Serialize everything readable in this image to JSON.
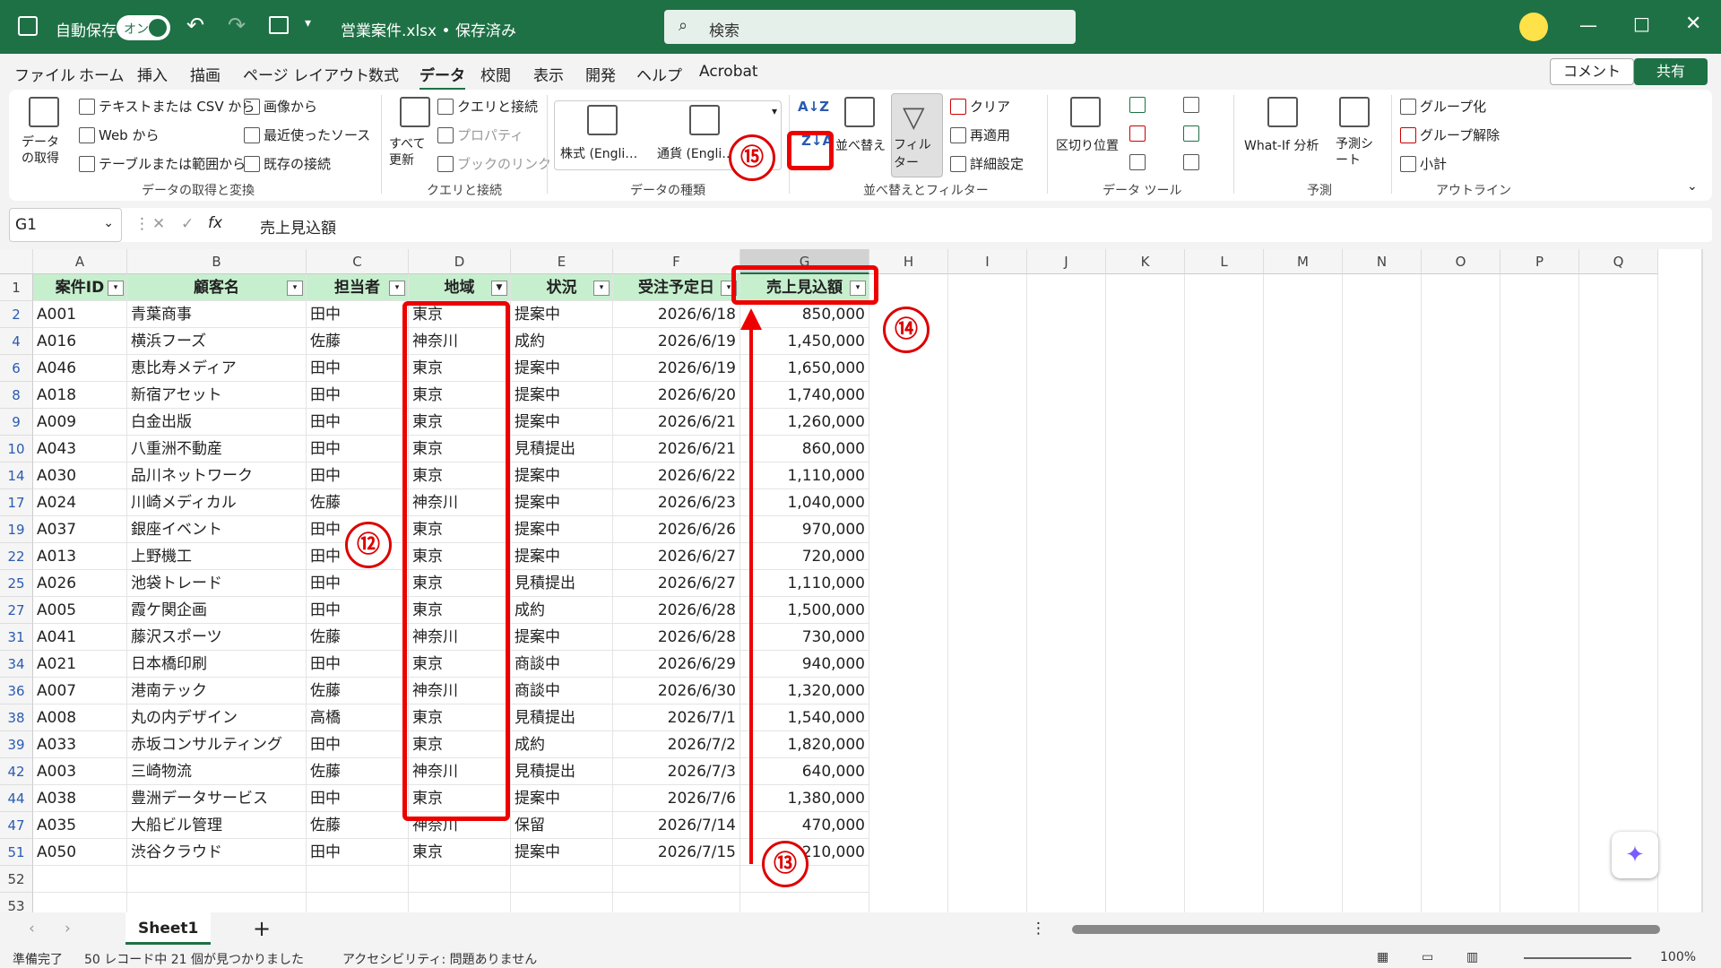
{
  "titlebar": {
    "autosave_label": "自動保存",
    "autosave_state": "オン",
    "file_name": "営業案件.xlsx • 保存済み",
    "search_placeholder": "検索"
  },
  "menu": {
    "tabs": [
      "ファイル",
      "ホーム",
      "挿入",
      "描画",
      "ページ レイアウト",
      "数式",
      "データ",
      "校閲",
      "表示",
      "開発",
      "ヘルプ",
      "Acrobat"
    ],
    "active_tab": "データ",
    "comment_label": "コメント",
    "share_label": "共有"
  },
  "ribbon": {
    "get_data": "データの取得",
    "from_text_csv": "テキストまたは CSV から",
    "from_web": "Web から",
    "from_table": "テーブルまたは範囲から",
    "from_image": "画像から",
    "recent_sources": "最近使ったソース",
    "existing_conn": "既存の接続",
    "group_get": "データの取得と変換",
    "refresh_all": "すべて更新",
    "queries_conn": "クエリと接続",
    "properties": "プロパティ",
    "book_links": "ブックのリンク",
    "group_queries": "クエリと接続",
    "stocks": "株式 (Engli…",
    "currency": "通貨 (Engli…",
    "group_types": "データの種類",
    "sort_asc": "A↓Z",
    "sort_desc": "Z↓A",
    "sort": "並べ替え",
    "filter": "フィルター",
    "clear": "クリア",
    "reapply": "再適用",
    "advanced": "詳細設定",
    "group_sort": "並べ替えとフィルター",
    "text_to_columns": "区切り位置",
    "group_tools": "データ ツール",
    "whatif": "What-If 分析",
    "forecast_sheet": "予測シート",
    "group_forecast": "予測",
    "group_btn": "グループ化",
    "ungroup_btn": "グループ解除",
    "subtotal": "小計",
    "group_outline": "アウトライン"
  },
  "formula_bar": {
    "name_box": "G1",
    "fx": "fx",
    "content": "売上見込額"
  },
  "columns": [
    "A",
    "B",
    "C",
    "D",
    "E",
    "F",
    "G",
    "H",
    "I",
    "J",
    "K",
    "L",
    "M",
    "N",
    "O",
    "P",
    "Q"
  ],
  "header_row": {
    "row_num": "1",
    "cells": [
      "案件ID",
      "顧客名",
      "担当者",
      "地域",
      "状況",
      "受注予定日",
      "売上見込額"
    ]
  },
  "rows": [
    {
      "n": "2",
      "c": [
        "A001",
        "青葉商事",
        "田中",
        "東京",
        "提案中",
        "2026/6/18",
        "850,000"
      ]
    },
    {
      "n": "4",
      "c": [
        "A016",
        "横浜フーズ",
        "佐藤",
        "神奈川",
        "成約",
        "2026/6/19",
        "1,450,000"
      ]
    },
    {
      "n": "6",
      "c": [
        "A046",
        "恵比寿メディア",
        "田中",
        "東京",
        "提案中",
        "2026/6/19",
        "1,650,000"
      ]
    },
    {
      "n": "8",
      "c": [
        "A018",
        "新宿アセット",
        "田中",
        "東京",
        "提案中",
        "2026/6/20",
        "1,740,000"
      ]
    },
    {
      "n": "9",
      "c": [
        "A009",
        "白金出版",
        "田中",
        "東京",
        "提案中",
        "2026/6/21",
        "1,260,000"
      ]
    },
    {
      "n": "10",
      "c": [
        "A043",
        "八重洲不動産",
        "田中",
        "東京",
        "見積提出",
        "2026/6/21",
        "860,000"
      ]
    },
    {
      "n": "14",
      "c": [
        "A030",
        "品川ネットワーク",
        "田中",
        "東京",
        "提案中",
        "2026/6/22",
        "1,110,000"
      ]
    },
    {
      "n": "17",
      "c": [
        "A024",
        "川崎メディカル",
        "佐藤",
        "神奈川",
        "提案中",
        "2026/6/23",
        "1,040,000"
      ]
    },
    {
      "n": "19",
      "c": [
        "A037",
        "銀座イベント",
        "田中",
        "東京",
        "提案中",
        "2026/6/26",
        "970,000"
      ]
    },
    {
      "n": "22",
      "c": [
        "A013",
        "上野機工",
        "田中",
        "東京",
        "提案中",
        "2026/6/27",
        "720,000"
      ]
    },
    {
      "n": "25",
      "c": [
        "A026",
        "池袋トレード",
        "田中",
        "東京",
        "見積提出",
        "2026/6/27",
        "1,110,000"
      ]
    },
    {
      "n": "27",
      "c": [
        "A005",
        "霞ケ関企画",
        "田中",
        "東京",
        "成約",
        "2026/6/28",
        "1,500,000"
      ]
    },
    {
      "n": "31",
      "c": [
        "A041",
        "藤沢スポーツ",
        "佐藤",
        "神奈川",
        "提案中",
        "2026/6/28",
        "730,000"
      ]
    },
    {
      "n": "34",
      "c": [
        "A021",
        "日本橋印刷",
        "田中",
        "東京",
        "商談中",
        "2026/6/29",
        "940,000"
      ]
    },
    {
      "n": "36",
      "c": [
        "A007",
        "港南テック",
        "佐藤",
        "神奈川",
        "商談中",
        "2026/6/30",
        "1,320,000"
      ]
    },
    {
      "n": "38",
      "c": [
        "A008",
        "丸の内デザイン",
        "高橋",
        "東京",
        "見積提出",
        "2026/7/1",
        "1,540,000"
      ]
    },
    {
      "n": "39",
      "c": [
        "A033",
        "赤坂コンサルティング",
        "田中",
        "東京",
        "成約",
        "2026/7/2",
        "1,820,000"
      ]
    },
    {
      "n": "42",
      "c": [
        "A003",
        "三崎物流",
        "佐藤",
        "神奈川",
        "見積提出",
        "2026/7/3",
        "640,000"
      ]
    },
    {
      "n": "44",
      "c": [
        "A038",
        "豊洲データサービス",
        "田中",
        "東京",
        "提案中",
        "2026/7/6",
        "1,380,000"
      ]
    },
    {
      "n": "47",
      "c": [
        "A035",
        "大船ビル管理",
        "佐藤",
        "神奈川",
        "保留",
        "2026/7/14",
        "470,000"
      ]
    },
    {
      "n": "51",
      "c": [
        "A050",
        "渋谷クラウド",
        "田中",
        "東京",
        "提案中",
        "2026/7/15",
        "1,210,000"
      ]
    }
  ],
  "extra_rows": [
    "52",
    "53"
  ],
  "annotations": {
    "c12": "⑫",
    "c13": "⑬",
    "c14": "⑭",
    "c15": "⑮"
  },
  "sheet_tabs": {
    "active": "Sheet1",
    "add": "+"
  },
  "status": {
    "ready": "準備完了",
    "records": "50 レコード中 21 個が見つかりました",
    "accessibility": "アクセシビリティ: 問題ありません",
    "zoom": "100%"
  },
  "colors": {
    "accent": "#1e7145",
    "header_fill": "#c6efce",
    "annotation": "#e00000"
  }
}
